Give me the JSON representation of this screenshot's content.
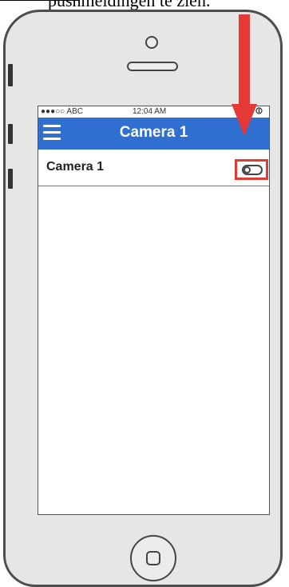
{
  "caption": "pushmeldingen te zien.",
  "status_bar": {
    "carrier": "●●●○○ ABC",
    "time": "12:04 AM",
    "battery_icon": "battery-icon"
  },
  "nav": {
    "title": "Camera 1",
    "menu_icon": "hamburger-menu-icon"
  },
  "rows": [
    {
      "label": "Camera 1",
      "toggle": "off"
    }
  ],
  "annotation": {
    "highlight_color": "#e53935",
    "arrow_icon": "down-arrow-annotation"
  },
  "colors": {
    "navbar": "#2f6fd0",
    "phone_body": "#e6e6e6"
  }
}
